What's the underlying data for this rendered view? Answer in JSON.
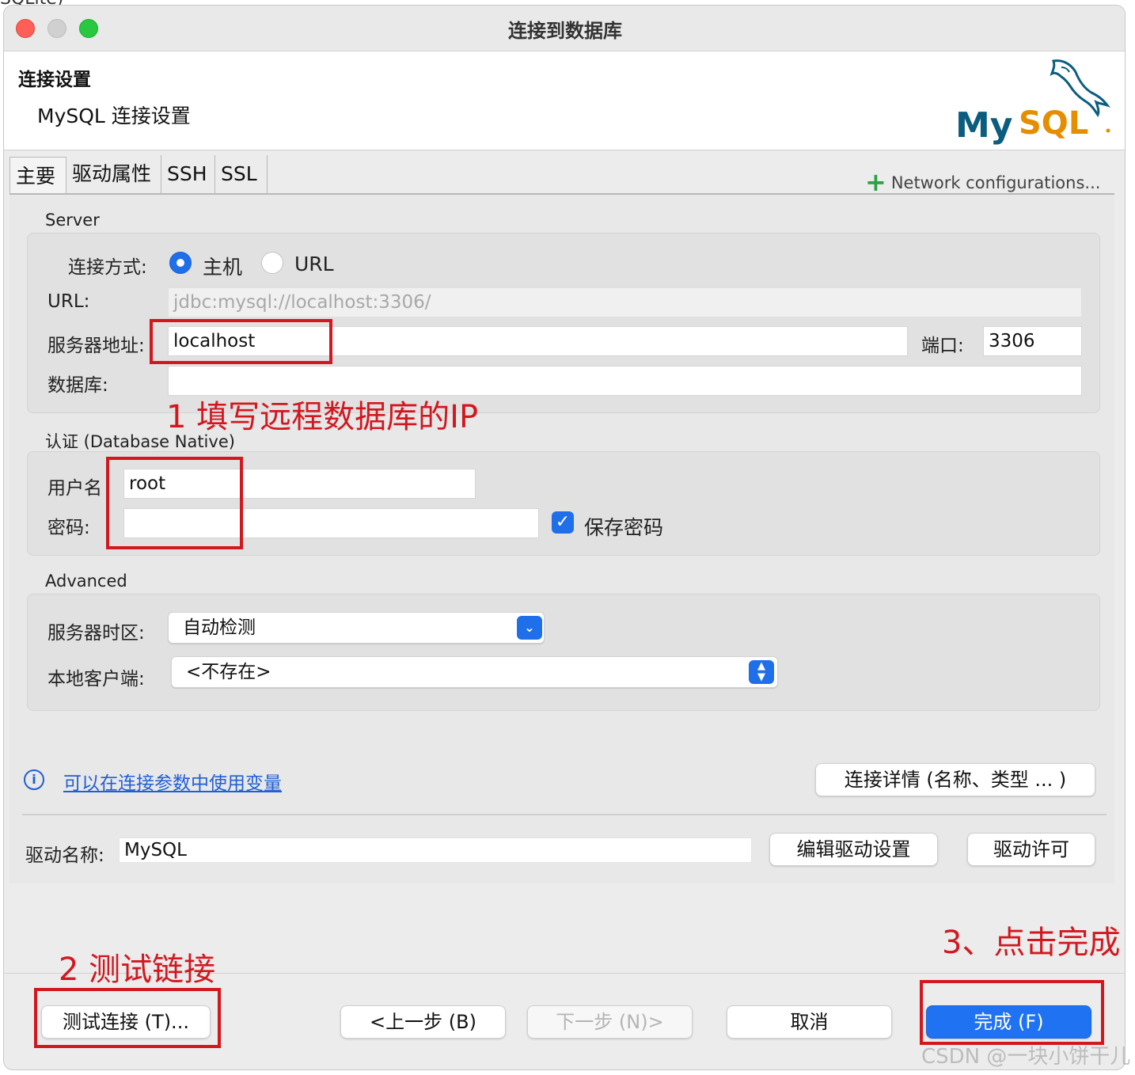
{
  "window": {
    "title": "连接到数据库"
  },
  "header": {
    "section_title": "连接设置",
    "subtitle": "MySQL 连接设置",
    "logo_text": "MySQL"
  },
  "tabs": [
    {
      "label": "主要",
      "active": true
    },
    {
      "label": "驱动属性"
    },
    {
      "label": "SSH"
    },
    {
      "label": "SSL"
    }
  ],
  "network_config": {
    "label": "Network configurations..."
  },
  "server": {
    "group_label": "Server",
    "connect_mode_label": "连接方式:",
    "mode_host_label": "主机",
    "mode_url_label": "URL",
    "mode_selected": "主机",
    "url_label": "URL:",
    "url_value": "jdbc:mysql://localhost:3306/",
    "host_label": "服务器地址:",
    "host_value": "localhost",
    "port_label": "端口:",
    "port_value": "3306",
    "database_label": "数据库:",
    "database_value": ""
  },
  "auth": {
    "group_label": "认证 (Database Native)",
    "username_label": "用户名",
    "username_value": "root",
    "password_label": "密码:",
    "password_value": "",
    "save_password_label": "保存密码",
    "save_password_checked": true
  },
  "advanced": {
    "group_label": "Advanced",
    "timezone_label": "服务器时区:",
    "timezone_value": "自动检测",
    "local_client_label": "本地客户端:",
    "local_client_value": "<不存在>"
  },
  "links": {
    "variables": "可以在连接参数中使用变量",
    "details_button": "连接详情 (名称、类型 ... )"
  },
  "driver": {
    "name_label": "驱动名称:",
    "name_value": "MySQL",
    "edit_button": "编辑驱动设置",
    "license_button": "驱动许可"
  },
  "footer": {
    "test_button": "测试连接 (T)...",
    "back_button": "<上一步 (B)",
    "next_button": "下一步 (N)>",
    "cancel_button": "取消",
    "finish_button": "完成 (F)"
  },
  "annotations": {
    "step1": "1 填写远程数据库的IP",
    "step2": "2 测试链接",
    "step3": "3、点击完成",
    "color": "#d3171f"
  },
  "background_text": "SQLite)",
  "watermark": "CSDN @一块小饼干儿",
  "colors": {
    "accent": "#1f6feb",
    "annotation": "#d3171f",
    "link": "#1f5fd6"
  }
}
